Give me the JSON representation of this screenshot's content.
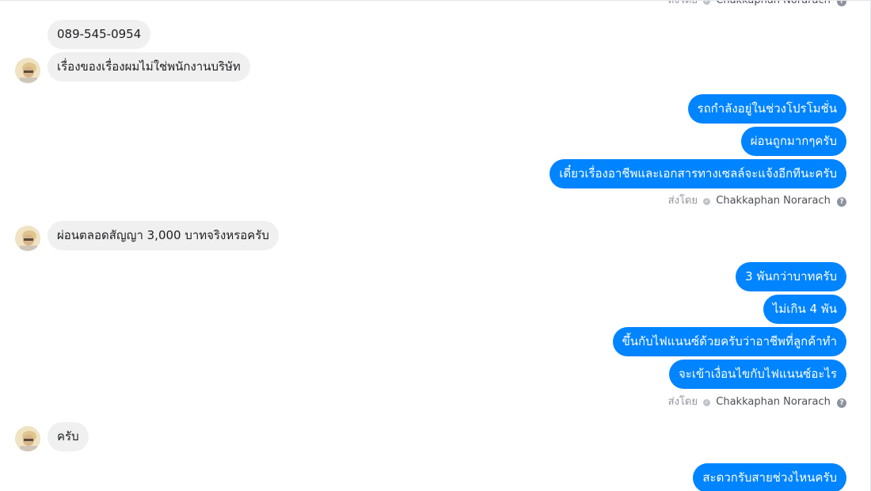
{
  "sent_by": {
    "label": "ส่งโดย",
    "agent_name": "Chakkaphan Norarach",
    "help_icon": "?"
  },
  "messages": {
    "in_1": "089-545-0954",
    "in_2": "เรื่องของเรื่องผมไม่ใช่พนักงานบริษัท",
    "out_1": "รถกำลังอยู่ในช่วงโปรโมชั่น",
    "out_2": "ผ่อนถูกมากๆครับ",
    "out_3": "เดี๋ยวเรื่องอาชีพและเอกสารทางเซลล์จะแจ้งอีกทีนะครับ",
    "in_3": "ผ่อนตลอดสัญญา 3,000 บาทจริงหรอครับ",
    "out_4": "3 พันกว่าบาทครับ",
    "out_5": "ไม่เกิน 4 พัน",
    "out_6": "ขึ้นกับไฟแนนซ์ด้วยครับว่าอาชีพที่ลูกค้าทำ",
    "out_7": "จะเข้าเงื่อนไขกับไฟแนนซ์อะไร",
    "in_4": "ครับ",
    "out_8": "สะดวกรับสายช่วงไหนครับ"
  },
  "colors": {
    "outgoing_bubble": "#0084ff",
    "incoming_bubble": "#f0f0f0",
    "agent_name": "#4b4f56"
  },
  "icons": {
    "avatar": "user-avatar-icon",
    "verified": "check-circle-icon",
    "help": "question-circle-icon"
  }
}
